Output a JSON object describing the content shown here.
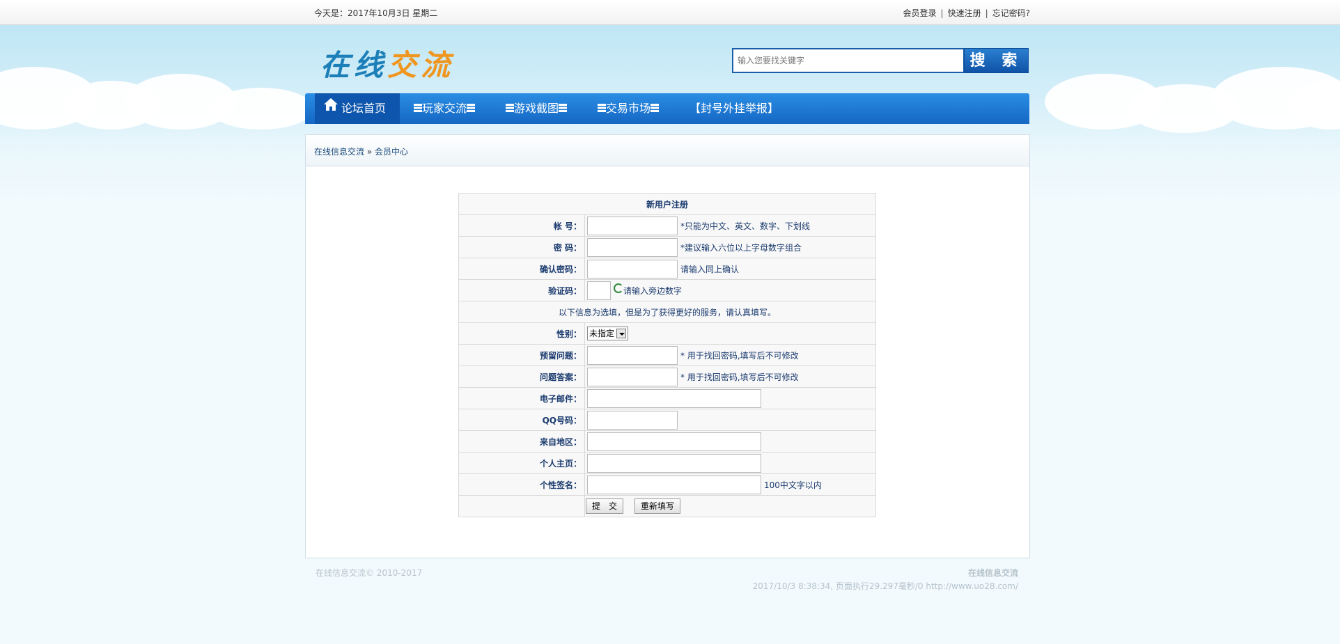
{
  "topbar": {
    "date": "今天是：2017年10月3日 星期二",
    "login": "会员登录",
    "register": "快速注册",
    "forgot": "忘记密码?"
  },
  "logo": {
    "part1": "在线",
    "part2": "交流"
  },
  "search": {
    "placeholder": "输入您要找关键字",
    "button": "搜 索"
  },
  "nav": [
    {
      "label": "论坛首页",
      "active": true
    },
    {
      "label": "玩家交流"
    },
    {
      "label": "游戏截图"
    },
    {
      "label": "交易市场"
    },
    {
      "label": "【封号外挂举报】"
    }
  ],
  "breadcrumb": {
    "root": "在线信息交流",
    "sep": " » ",
    "current": "会员中心"
  },
  "form": {
    "title": "新用户注册",
    "account": {
      "label": "帐 号：",
      "hint": "*只能为中文、英文、数字、下划线"
    },
    "password": {
      "label": "密 码：",
      "hint": "*建议输入六位以上字母数字组合"
    },
    "confirm": {
      "label": "确认密码：",
      "hint": "请输入同上确认"
    },
    "captcha": {
      "label": "验证码：",
      "hint": "请输入旁边数字"
    },
    "optional_note": "以下信息为选填，但是为了获得更好的服务，请认真填写。",
    "gender": {
      "label": "性别：",
      "selected": "未指定"
    },
    "question": {
      "label": "预留问题：",
      "hint": "* 用于找回密码,填写后不可修改"
    },
    "answer": {
      "label": "问题答案：",
      "hint": "* 用于找回密码,填写后不可修改"
    },
    "email": {
      "label": "电子邮件："
    },
    "qq": {
      "label": "QQ号码："
    },
    "region": {
      "label": "来自地区："
    },
    "homepage": {
      "label": "个人主页："
    },
    "signature": {
      "label": "个性签名：",
      "hint": "100中文字以内"
    },
    "submit": "提　交",
    "reset": "重新填写"
  },
  "footer": {
    "copyright": "在线信息交流© 2010-2017",
    "site": "在线信息交流",
    "stats": "2017/10/3 8:38:34, 页面执行29.297毫秒/0 http://www.uo28.com/"
  }
}
